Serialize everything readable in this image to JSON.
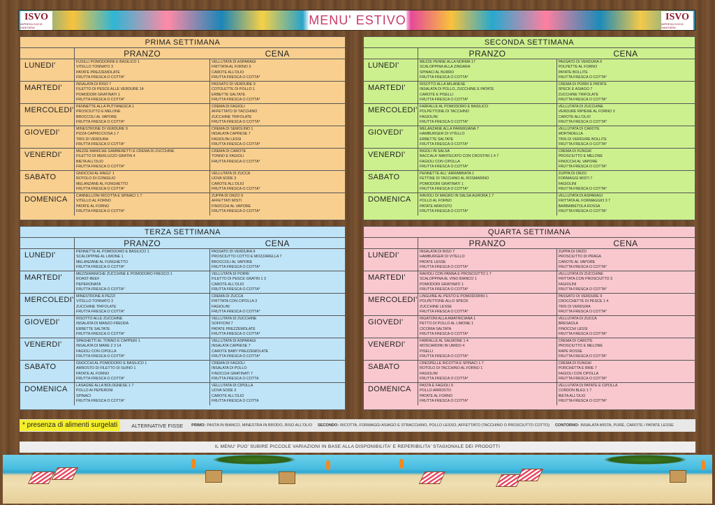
{
  "header": {
    "title": "MENU' ESTIVO",
    "logo_main": "ISVO",
    "logo_sub": "IMPRESA SOCIO SANITARIA"
  },
  "weeks": [
    {
      "title": "PRIMA SETTIMANA",
      "col_lunch": "PRANZO",
      "col_dinner": "CENA",
      "rows": [
        {
          "day": "LUNEDI'",
          "pranzo": [
            "FUSILLI POMODORINI E BASILICO 1",
            "VITELLO TONNATO 3",
            "PATATE PREZZEMOLATE",
            "FRUTTA FRESCA O COTTA*"
          ],
          "cena": [
            "VELLUTATA DI ASPARAGI",
            "FRITTATA AL FORNO 3",
            "CAROTE ALL'OLIO",
            "FRUTTA FRESCA O COTTA*"
          ]
        },
        {
          "day": "MARTEDI'",
          "pranzo": [
            "INSALATA DI RISO 7",
            "FILETTO DI PESCE ALLE VERDURE 14",
            "POMODORI GRATINATI 1",
            "FRUTTA FRESCA O COTTA*"
          ],
          "cena": [
            "PASSATO DI VERDURE 9",
            "COTOLETTE DI POLLO 1",
            "ERBETTE SALTATE",
            "FRUTTA FRESCA O COTTA*"
          ]
        },
        {
          "day": "MERCOLEDI'",
          "pranzo": [
            "PENNETTE ALLA PUTTANESCA 1",
            "PROSCIUTTO E MELONE",
            "BROCCOLI AL VAPORE",
            "FRUTTA FRESCA O COTTA*"
          ],
          "cena": [
            "CREMA DI FAGIOLI",
            "AFFETTATO DI TACCHINO",
            "ZUCCHINE TRIFOLATE",
            "FRUTTA FRESCA O COTTA*"
          ]
        },
        {
          "day": "GIOVEDI'",
          "pranzo": [
            "MINESTRONE DI VERDURE 9",
            "PIZZA CAPRICCIOSA 1 7",
            "TRIS DI VERDURA",
            "FRUTTA FRESCA O COTTA*"
          ],
          "cena": [
            "CREMA DI SEMOLINO 1",
            "INSALATA CAPRESE 7",
            "FAGIOLINI LESSI",
            "FRUTTA FRESCA O COTTA*"
          ]
        },
        {
          "day": "VENERDI'",
          "pranzo": [
            "MEZZE MANICHE GAMBERETTI E CREMA DI ZUCCHINE",
            "FILETTO DI MERLUZZO GRATIN 4",
            "BIETA ALL'OLIO",
            "FRUTTA FRESCA O COTTA*"
          ],
          "cena": [
            "CREMA DI CAROTE",
            "TONNO E FAGIOLI",
            "",
            "FRUTTA FRESCA O COTTA*"
          ]
        },
        {
          "day": "SABATO",
          "pranzo": [
            "GNOCCHI AL RAGU' 1",
            "ROTOLO DI CONIGLIO",
            "MELANZANE AL FUNGHETTO",
            "FRUTTA FRESCA O COTTA*"
          ],
          "cena": [
            "VELLUTATA DI ZUCCA",
            "UOVA SODE 3",
            "CAROTE ALL'OLIO",
            "FRUTTA FRESCA O COTTA*"
          ]
        },
        {
          "day": "DOMENICA",
          "pranzo": [
            "CANNELLONI RICOTTA E SPINACI 1 7",
            "VITELLO AL FORNO",
            "PATATE AL FORNO",
            "FRUTTA FRESCA O COTTA*"
          ],
          "cena": [
            "ZUPPA DI ORZO 9",
            "AFFETTATI MISTI",
            "FINOCCHI AL VAPORE",
            "FRUTTA FRESCA O COTTA*"
          ]
        }
      ]
    },
    {
      "title": "SECONDA SETTIMANA",
      "col_lunch": "PRANZO",
      "col_dinner": "CENA",
      "rows": [
        {
          "day": "LUNEDI'",
          "pranzo": [
            "MEZZE PENNE ALLA NORMA 17",
            "SCALOPPINA ALLA ZINGARA",
            "SPINACI AL BURRO",
            "FRUTTA FRESCA O COTTA*"
          ],
          "cena": [
            "PASSATO DI VERDURA 9",
            "POLPETTE AL FORNO",
            "PATATE BOLLITE",
            "FRUTTA FRESCA O COTTA*"
          ]
        },
        {
          "day": "MARTEDI'",
          "pranzo": [
            "RISOTTO ALLA MILANESE",
            "INSALATA DI POLLO, ZUCCHINE E PATATE",
            "CAROTE E PISELLI",
            "FRUTTA FRESCA O COTTA*"
          ],
          "cena": [
            "CREMA DI PORRI E PATATE",
            "SPECK E ASIAGO 7",
            "ZUCCHINE TRIFOLATE",
            "FRUTTA FRESCA O COTTA*"
          ]
        },
        {
          "day": "MERCOLEDI'",
          "pranzo": [
            "FARFALLE AL POMODORO E BASILICO",
            "POLPETTONE DI TACCHINO",
            "FAGIOLINI",
            "FRUTTA FRESCA O COTTA*"
          ],
          "cena": [
            "VELLUTATA DI ZUCCHINE",
            "VERDURE RIPIENE AL FORNO 3",
            "CAROTE ALL'OLIO",
            "FRUTTA FRESCA O COTTA*"
          ]
        },
        {
          "day": "GIOVEDI'",
          "pranzo": [
            "MELANZANE ALLA PARMIGIANA 7",
            "HAMBURGER DI VITELLO",
            "ERBETTE SALTATE",
            "FRUTTA FRESCA O COTTA*"
          ],
          "cena": [
            "VELLUTATA DI CAROTE",
            "MORTADELLA",
            "TRIS DI VERDURE BOLLITE",
            "FRUTTA FRESCA O COTTA*"
          ]
        },
        {
          "day": "VENERDI'",
          "pranzo": [
            "BIGOLI IN SALSA",
            "BACCALA' MANTECATO CON CROSTINI 1 4 7",
            "FAGIOLI CON CIPOLLA",
            "FRUTTA FRESCA O COTTA*"
          ],
          "cena": [
            "CREMA DI FUNGHI",
            "PROSCIUTTO E MELONE",
            "FINOCCHI AL VAPORE",
            "FRUTTA FRESCA O COTTA*"
          ]
        },
        {
          "day": "SABATO",
          "pranzo": [
            "PENNETTE ALL' ARRABBIATA 1",
            "FETTINE DI TACCHINO AL ROSMARINO",
            "POMODORI GRATINATI 1",
            "FRUTTA FRESCA O COTTA*"
          ],
          "cena": [
            "ZUPPA DI ORZO",
            "FORMAGGI MISTI 7",
            "FAGIOLINI",
            "FRUTTA FRESCA O COTTA*"
          ]
        },
        {
          "day": "DOMENICA",
          "pranzo": [
            "RAVIOLI DI MAGRO IN SALSA AURORA 1 7",
            "POLLO AL FORNO",
            "PATATE ARROSTO",
            "FRUTTA FRESCA O COTTA*"
          ],
          "cena": [
            "VELLUTATA DI ASPARAGI",
            "FRITTATA AL FORMAGGIO 3 7",
            "BARBABIETOLA ROSSA",
            "FRUTTA FRESCA O COTTA*"
          ]
        }
      ]
    },
    {
      "title": "TERZA SETTIMANA",
      "col_lunch": "PRANZO",
      "col_dinner": "CENA",
      "rows": [
        {
          "day": "LUNEDI'",
          "pranzo": [
            "PENNETTE AL POMODORO E BASILICO 1",
            "SCALOPPINE AL LIMONE 1",
            "MELANZANE AL FUNGHETTO",
            "FRUTTA FRESCA O COTTA*"
          ],
          "cena": [
            "PASSATO DI VERDURA 9",
            "PROSCIUTTO COTTO E MOZZARELLA 7",
            "BROCCOLI AL VAPORE",
            "FRUTTA FRESCA O COTTA*"
          ]
        },
        {
          "day": "MARTEDI'",
          "pranzo": [
            "MEZZEMANICHE ZUCCHINE E POMODORO FRESCO 1",
            "ROAST-BEEF",
            "PEPERONATA",
            "FRUTTA FRESCA O COTTA*"
          ],
          "cena": [
            "VELLUTATA DI PORRI",
            "FILETTO DI PESCE GRATIN 1 3",
            "CAROTE ALL'OLIO",
            "FRUTTA FRESCA O COTTA*"
          ]
        },
        {
          "day": "MERCOLEDI'",
          "pranzo": [
            "MINESTRONE A PEZZI",
            "VITELLO TONNATO 3",
            "ZUCCHINE TRIFOLATE",
            "FRUTTA FRESCA O COTTA*"
          ],
          "cena": [
            "CREMA DI ZUCCA",
            "FRITTATA CON CIPOLLA 3",
            "FAGIOLINI",
            "FRUTTA FRESCA O COTTA*"
          ]
        },
        {
          "day": "GIOVEDI'",
          "pranzo": [
            "RISOTTO ALLE ZUCCHINE",
            "INSALATA DI MANZO FREDDA",
            "ERBETTE SALTATE",
            "FRUTTA FRESCA O COTTA*"
          ],
          "cena": [
            "VELLUTATA DI ZUCCHINE",
            "SOFFICINI 7",
            "PATATE PREZZEMOLATE",
            "FRUTTA FRESCA O COTTA*"
          ]
        },
        {
          "day": "VENERDI'",
          "pranzo": [
            "SPAGHETTI AL TONNO E CAPPERI 1",
            "INSALATA DI MARE 2 3 14",
            "FAGIOLI CON CIPOLLA",
            "FRUTTA FRESCA O COTTA*"
          ],
          "cena": [
            "VELLUTATA DI ASPARAGI",
            "INSALATA CAPRESE 7",
            "CAROTE BABY PREZZEMOLATE",
            "FRUTTA FRESCA O COTTA*"
          ]
        },
        {
          "day": "SABATO",
          "pranzo": [
            "GNOCCHI AL POMODORO E BASILICO 1",
            "ARROSTO DI FILETTO DI SUINO 1",
            "PATATE AL FORNO",
            "FRUTTA FRESCA O COTTA*"
          ],
          "cena": [
            "CREMA DI FAGIOLI",
            "INSALATA DI POLLO",
            "FINOCCHI GRATINATI 7",
            "FRUTTA FRESCA O COTTA"
          ]
        },
        {
          "day": "DOMENICA",
          "pranzo": [
            "LASAGNE ALLA BOLOGNESE 1 7",
            "POLLO AI PEPERONI",
            "SPINACI",
            "FRUTTA FRESCA O COTTA*"
          ],
          "cena": [
            "VELLUTATA DI CIPOLLA",
            "UOVA SODE 3",
            "CAROTE ALL'OLIO",
            "FRUTTA FRESCA O COTTA"
          ]
        }
      ]
    },
    {
      "title": "QUARTA SETTIMANA",
      "col_lunch": "PRANZO",
      "col_dinner": "CENA",
      "rows": [
        {
          "day": "LUNEDI'",
          "pranzo": [
            "INSALATA DI RISO 7",
            "HAMBURGER DI VITELLO",
            "PATATE LESSE",
            "FRUTTA FRESCA O COTTA*"
          ],
          "cena": [
            "ZUPPA DI ORZO",
            "PROSCIUTTO DI PRAGA",
            "CAROTE AL VAPORE",
            "FRUTTA FRESCA O COTTA*"
          ]
        },
        {
          "day": "MARTEDI'",
          "pranzo": [
            "RAVIOLI CON PANNA E PROSCIUTTO 1 7",
            "SCALOPPINA AL VINO BIANCO 1",
            "POMODORI GRATINATI 1",
            "FRUTTA FRESCA O COTTA*"
          ],
          "cena": [
            "VELLUTATA DI ZUCCHINE",
            "FRITTATA CON PROSCIUTTO 3",
            "FAGIOLINI",
            "FRUTTA FRESCA O COTTA*"
          ]
        },
        {
          "day": "MERCOLEDI'",
          "pranzo": [
            "LINGUINE AL PESTO E POMODORINI 1",
            "POLPETTONE ALLO SPECK",
            "ZUCCHINE LESSE",
            "FRUTTA FRESCA O COTTA*"
          ],
          "cena": [
            "PASSATO DI VERDURE 9",
            "CROCCHETTE DI PESCE 1 4",
            "TRIS DI VERDURA",
            "FRUTTA FRESCA O COTTA*"
          ]
        },
        {
          "day": "GIOVEDI'",
          "pranzo": [
            "RIGATONI ALLA AMATRICIANA 1",
            "PETTO DI POLLO AL LIMONE 1",
            "CICORIA SALTATA",
            "FRUTTA FRESCA O COTTA*"
          ],
          "cena": [
            "VELLUTATA DI ZUCCA",
            "BRESAOLA",
            "FINOCCHI LESSI",
            "FRUTTA FRESCA O COTTA*"
          ]
        },
        {
          "day": "VENERDI'",
          "pranzo": [
            "FARFALLE AL SALMONE 1 4",
            "MOSCARDINI IN UMIDO 4",
            "PISELLI",
            "FRUTTA FRESCA O COTTA*"
          ],
          "cena": [
            "CREMA DI CAROTE",
            "PROSCIUTTO E MELONE",
            "RAPE ROSSE",
            "FRUTTA FRESCA O COTTA*"
          ]
        },
        {
          "day": "SABATO",
          "pranzo": [
            "CRESPELLE RICOTTA E SPINACI 1 7",
            "ROTOLO DI TACCHINO AL FORNO 1",
            "FAGIOLINI",
            "FRUTTA FRESCA O COTTA*"
          ],
          "cena": [
            "CREMA DI FUNGHI",
            "PORCHETTA E BRIE 7",
            "FAGIOLI CON CIPOLLA",
            "FRUTTA FRESCA O COTTA*"
          ]
        },
        {
          "day": "DOMENICA",
          "pranzo": [
            "PASTA E FAGIOLI 9",
            "POLLO ARROSTO",
            "PATATE AL FORNO",
            "FRUTTA FRESCA O COTTA*"
          ],
          "cena": [
            "VELLUTATA DI PATATE E CIPOLLA",
            "CORDON BLEU 1 7",
            "BIETA ALL'OLIO",
            "FRUTTA FRESCA O COTTA*"
          ]
        }
      ]
    }
  ],
  "legend": {
    "frozen": "* presenza di alimenti surgelati",
    "alt_title": "ALTERNATIVE FISSE",
    "primo_label": "PRIMO:",
    "primo": "PASTA IN BIANCO, MINESTRA IN BRODO, RISO ALL'OLIO",
    "secondo_label": "SECONDO:",
    "secondo": "RICOTTA, FORMAGGI ASIAGO E STRACCHINO, POLLO LESSO, AFFETTATO (TACCHINO O PROSCIUTTO COTTO)",
    "contorno_label": "CONTORNO:",
    "contorno": "INSALATA MISTA, PURÈ, CAROTE / PATATE LESSE"
  },
  "note": "IL MENU' PUO' SUBIRE PICCOLE VARIAZIONI IN BASE ALLA DISPONIBILITA' E REPERIBILITA' STAGIONALE DEI PRODOTTI",
  "colors": {
    "week1": "#f9cf8f",
    "week2": "#cdf08e",
    "week3": "#bfe4f7",
    "week4": "#f9c8cf",
    "title": "#c73a66",
    "frozen_highlight": "#f5ef2b"
  }
}
